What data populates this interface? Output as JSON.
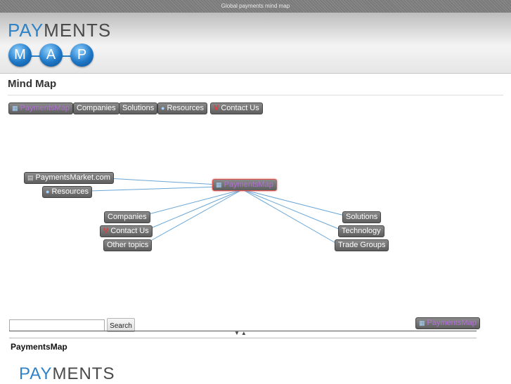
{
  "topbar": {
    "text": "Global payments mind map"
  },
  "logo": {
    "word_blue": "PAY",
    "word_dark": "MENTS",
    "letters": [
      "M",
      "A",
      "P"
    ]
  },
  "page": {
    "title": "Mind Map"
  },
  "breadcrumbs": [
    {
      "label": "PaymentsMap",
      "icon": "window-icon"
    },
    {
      "label": "Companies"
    },
    {
      "label": "Solutions"
    },
    {
      "label": "Resources",
      "icon": "globe-icon"
    },
    {
      "label": "Contact Us",
      "icon": "v-icon",
      "icon_glyph": "V"
    }
  ],
  "map": {
    "center": {
      "label": "PaymentsMap",
      "icon": "window-icon"
    },
    "nodes": {
      "paymentsmarket": {
        "label": "PaymentsMarket.com",
        "icon": "link-icon"
      },
      "resources": {
        "label": "Resources",
        "icon": "globe-icon"
      },
      "companies": {
        "label": "Companies"
      },
      "contact": {
        "label": "Contact Us",
        "icon": "v-icon",
        "icon_glyph": "V"
      },
      "other": {
        "label": "Other topics"
      },
      "solutions": {
        "label": "Solutions"
      },
      "technology": {
        "label": "Technology"
      },
      "trade": {
        "label": "Trade Groups"
      }
    },
    "line_color": "#6aa6d6"
  },
  "search": {
    "value": "",
    "button_label": "Search"
  },
  "current_node": {
    "label": "PaymentsMap"
  },
  "detail": {
    "title": "PaymentsMap",
    "logo_blue": "PAY",
    "logo_dark": "MENTS"
  },
  "colors": {
    "brand_blue": "#2f82c6",
    "node_bg": "#6e6e6e",
    "active_border": "#d9534f"
  }
}
